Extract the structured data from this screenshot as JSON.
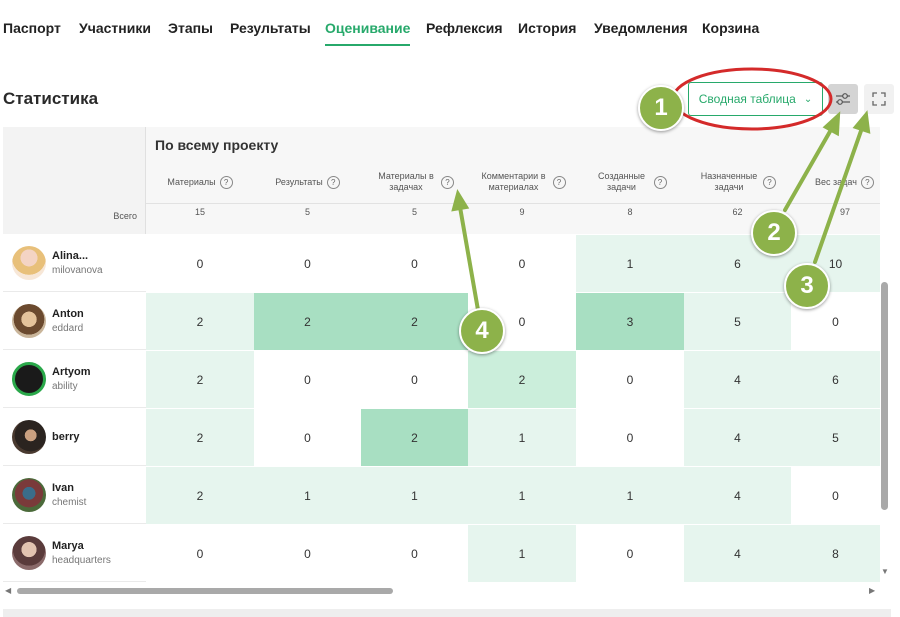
{
  "tabs": [
    {
      "label": "Паспорт",
      "active": false
    },
    {
      "label": "Участники",
      "active": false
    },
    {
      "label": "Этапы",
      "active": false
    },
    {
      "label": "Результаты",
      "active": false
    },
    {
      "label": "Оценивание",
      "active": true
    },
    {
      "label": "Рефлексия",
      "active": false
    },
    {
      "label": "История",
      "active": false
    },
    {
      "label": "Уведомления",
      "active": false
    },
    {
      "label": "Корзина",
      "active": false
    }
  ],
  "page_title": "Статистика",
  "toolbar": {
    "view_select_label": "Сводная таблица",
    "filter_icon": "sliders-icon",
    "fullscreen_icon": "fullscreen-icon"
  },
  "table": {
    "group_title": "По всему проекту",
    "total_label": "Всего",
    "columns": [
      {
        "label": "Материалы",
        "total": "15"
      },
      {
        "label": "Результаты",
        "total": "5"
      },
      {
        "label": "Материалы в задачах",
        "total": "5"
      },
      {
        "label": "Комментарии в материалах",
        "total": "9"
      },
      {
        "label": "Созданные задачи",
        "total": "8"
      },
      {
        "label": "Назначенные задачи",
        "total": "62"
      },
      {
        "label": "Вес задач",
        "total": "97"
      }
    ],
    "rows": [
      {
        "name": "Alina...",
        "login": "milovanova",
        "values": [
          "0",
          "0",
          "0",
          "0",
          "1",
          "6",
          "10"
        ]
      },
      {
        "name": "Anton",
        "login": "eddard",
        "values": [
          "2",
          "2",
          "2",
          "0",
          "3",
          "5",
          "0"
        ]
      },
      {
        "name": "Artyom",
        "login": "ability",
        "values": [
          "2",
          "0",
          "0",
          "2",
          "0",
          "4",
          "6"
        ]
      },
      {
        "name": "berry",
        "login": "",
        "values": [
          "2",
          "0",
          "2",
          "1",
          "0",
          "4",
          "5"
        ]
      },
      {
        "name": "Ivan",
        "login": "chemist",
        "values": [
          "2",
          "1",
          "1",
          "1",
          "1",
          "4",
          "0"
        ]
      },
      {
        "name": "Marya",
        "login": "headquarters",
        "values": [
          "0",
          "0",
          "0",
          "1",
          "0",
          "4",
          "8"
        ]
      }
    ]
  },
  "annotations": [
    "1",
    "2",
    "3",
    "4"
  ],
  "colors": {
    "accent": "#27a96b",
    "heat_light": "#e6f5ee",
    "heat_mid": "#cbeedb",
    "heat_strong": "#a8dfc2",
    "callout": "#8db24a",
    "highlight_ring": "#d42a2a"
  }
}
